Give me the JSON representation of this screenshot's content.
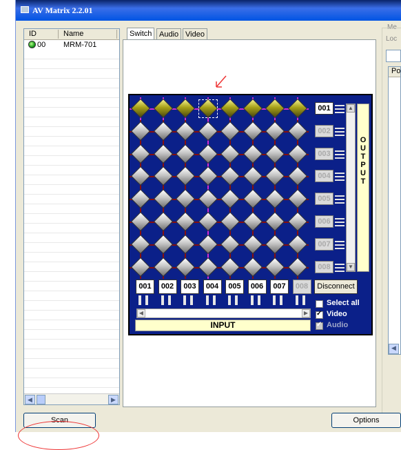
{
  "window": {
    "title": "AV Matrix 2.2.01"
  },
  "device_list": {
    "columns": [
      "ID",
      "Name"
    ],
    "rows": [
      {
        "id": "00",
        "name": "MRM-701",
        "status": "online"
      }
    ]
  },
  "tabs": [
    "Switch",
    "Audio",
    "Video"
  ],
  "active_tab": "Switch",
  "matrix": {
    "outputs": [
      "001",
      "002",
      "003",
      "004",
      "005",
      "006",
      "007",
      "008"
    ],
    "inputs": [
      "001",
      "002",
      "003",
      "004",
      "005",
      "006",
      "007",
      "008"
    ],
    "active_outputs": [
      "001"
    ],
    "active_inputs": [
      "001",
      "002",
      "003",
      "004",
      "005",
      "006",
      "007"
    ],
    "connections": [
      {
        "output": "001",
        "input": "004"
      }
    ],
    "output_label": "O U T P U T",
    "input_label": "INPUT",
    "disconnect_label": "Disconnect",
    "select_all_label": "Select all",
    "video_label": "Video",
    "audio_label": "Audio",
    "select_all": false,
    "video": true,
    "audio": true
  },
  "right_panel": {
    "top_label_1": "Me",
    "top_label_2": "Loc",
    "col_header": "Po"
  },
  "buttons": {
    "scan": "Scan",
    "options": "Options"
  },
  "colors": {
    "matrix_bg": "#0b2089",
    "active_route": "#d42ad4",
    "titlebar": "#0054e3",
    "annotation": "#e33333"
  }
}
